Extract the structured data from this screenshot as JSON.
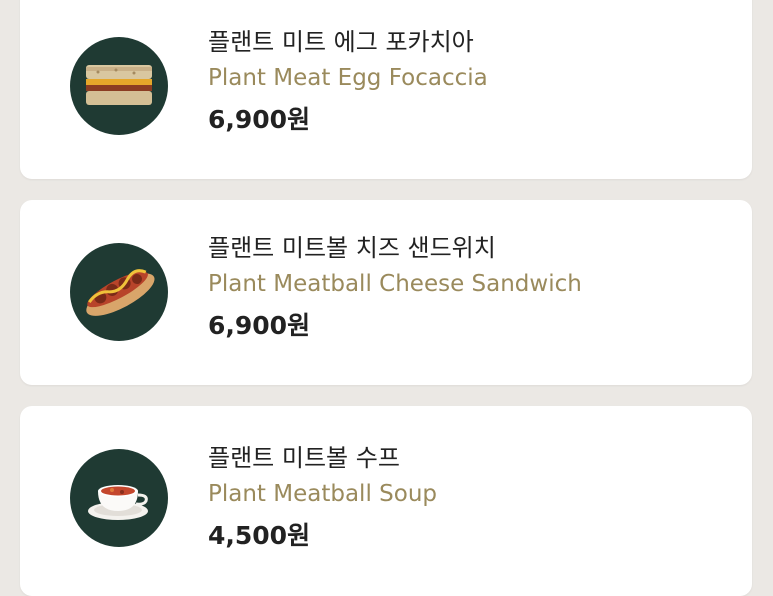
{
  "menu": {
    "items": [
      {
        "name_ko": "플랜트 미트 에그 포카치아",
        "name_en": "Plant Meat Egg Focaccia",
        "price": "6,900원",
        "image_icon": "focaccia-sandwich-icon"
      },
      {
        "name_ko": "플랜트 미트볼 치즈 샌드위치",
        "name_en": "Plant Meatball Cheese Sandwich",
        "price": "6,900원",
        "image_icon": "meatball-sandwich-icon"
      },
      {
        "name_ko": "플랜트 미트볼 수프",
        "name_en": "Plant Meatball Soup",
        "price": "4,500원",
        "image_icon": "soup-cup-icon"
      }
    ]
  },
  "colors": {
    "background": "#ebe8e4",
    "card": "#ffffff",
    "thumb_circle": "#1f3a33",
    "english_name": "#9a8a5c",
    "text_primary": "#222222"
  }
}
